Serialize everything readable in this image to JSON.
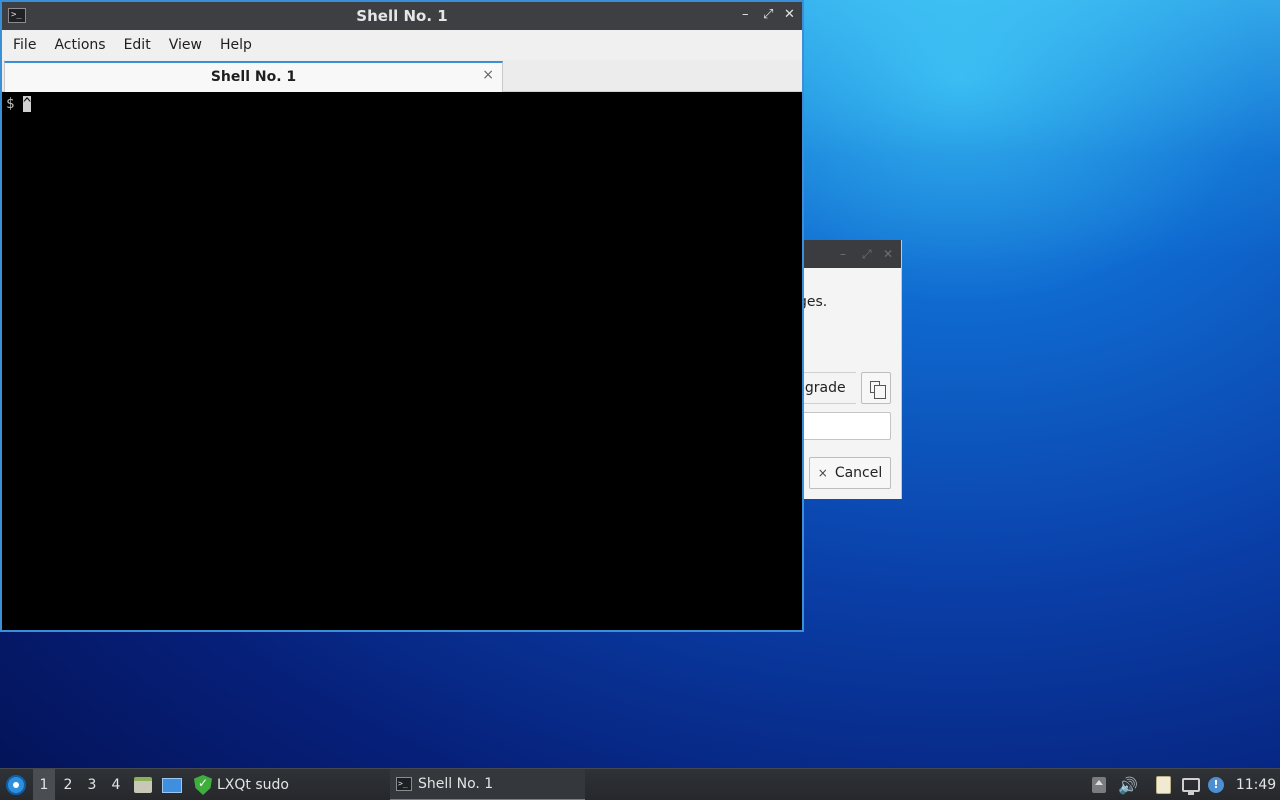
{
  "terminal_window": {
    "title": "Shell No. 1",
    "app_icon_glyph": ">_",
    "controls": {
      "minimize": "–",
      "maximize": "⤢",
      "close": "✕"
    },
    "menu": [
      "File",
      "Actions",
      "Edit",
      "View",
      "Help"
    ],
    "tab": {
      "label": "Shell No. 1",
      "close_glyph": "×"
    },
    "content": {
      "prompt": "$ ",
      "cursor_char": "^"
    }
  },
  "background_dialog": {
    "text_fragment": "ges.",
    "command_fragment": "pgrade",
    "cancel_label": "Cancel",
    "cancel_glyph": "×",
    "controls": {
      "minimize": "–",
      "maximize": "⤢",
      "close": "✕"
    }
  },
  "taskbar": {
    "desktops": [
      "1",
      "2",
      "3",
      "4"
    ],
    "active_desktop": "1",
    "sudo_label": "LXQt sudo",
    "task_label": "Shell No. 1",
    "task_icon_glyph": ">_",
    "volume_glyph": "🔊",
    "update_glyph": "!",
    "clock": "11:49"
  },
  "colors": {
    "accent": "#3b8fd8",
    "titlebar": "#3d3f43",
    "terminal_bg": "#000000",
    "taskbar": "#2f3236"
  }
}
